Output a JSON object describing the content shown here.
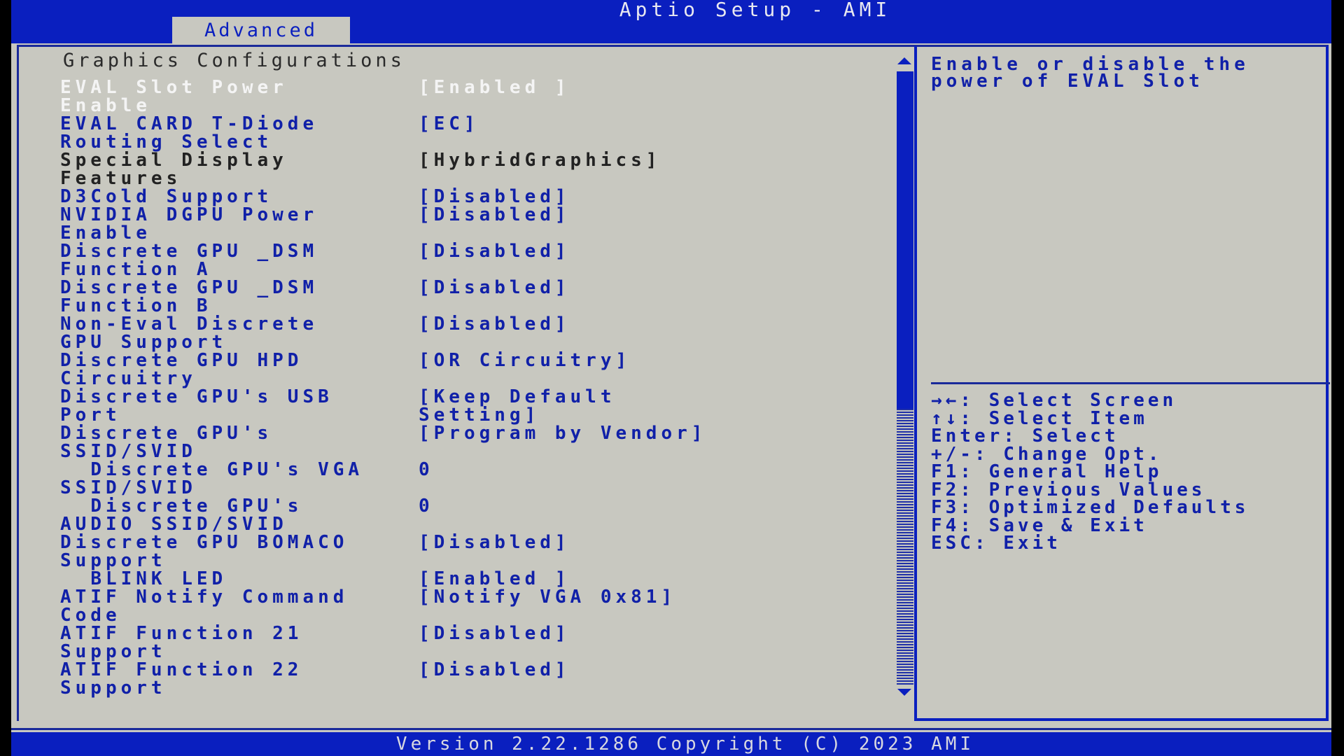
{
  "header": {
    "app_title": "Aptio Setup - AMI",
    "active_tab": "Advanced"
  },
  "main": {
    "section_title": "Graphics Configurations",
    "settings": [
      {
        "label": "EVAL Slot Power\nEnable",
        "value": "[Enabled ]",
        "state": "selected"
      },
      {
        "label": "EVAL CARD T-Diode\nRouting Select",
        "value": "[EC]"
      },
      {
        "label": "Special Display\nFeatures",
        "value": "[HybridGraphics]",
        "state": "readonly"
      },
      {
        "label": "D3Cold Support",
        "value": "[Disabled]"
      },
      {
        "label": "NVIDIA DGPU Power\nEnable",
        "value": "[Disabled]"
      },
      {
        "label": "Discrete GPU _DSM\nFunction A",
        "value": "[Disabled]"
      },
      {
        "label": "Discrete GPU _DSM\nFunction B",
        "value": "[Disabled]"
      },
      {
        "label": "Non-Eval Discrete\nGPU Support",
        "value": "[Disabled]"
      },
      {
        "label": "Discrete GPU HPD\nCircuitry",
        "value": "[OR Circuitry]"
      },
      {
        "label": "Discrete GPU's USB\nPort",
        "value": "[Keep Default\nSetting]"
      },
      {
        "label": "Discrete GPU's\nSSID/SVID",
        "value": "[Program by Vendor]"
      },
      {
        "label": "  Discrete GPU's VGA\nSSID/SVID",
        "value": "0",
        "indent": true
      },
      {
        "label": "  Discrete GPU's\nAUDIO SSID/SVID",
        "value": "0",
        "indent": true
      },
      {
        "label": "Discrete GPU BOMACO\nSupport",
        "value": "[Disabled]"
      },
      {
        "label": "  BLINK LED",
        "value": "[Enabled ]",
        "indent": true
      },
      {
        "label": "ATIF Notify Command\nCode",
        "value": "[Notify VGA 0x81]"
      },
      {
        "label": "ATIF Function 21\nSupport",
        "value": "[Disabled]"
      },
      {
        "label": "ATIF Function 22\nSupport",
        "value": "[Disabled]"
      }
    ],
    "scroll": {
      "position_fraction": 0.0,
      "visible_fraction": 0.55
    }
  },
  "help": {
    "description": "Enable or disable the power of EVAL Slot",
    "keys": [
      "→←: Select Screen",
      "↑↓: Select Item",
      "Enter: Select",
      "+/-: Change Opt.",
      "F1: General Help",
      "F2: Previous Values",
      "F3: Optimized Defaults",
      "F4: Save & Exit",
      "ESC: Exit"
    ]
  },
  "footer": {
    "text": "Version 2.22.1286 Copyright (C) 2023 AMI"
  },
  "colors": {
    "accent_blue": "#0a1fbf",
    "background_gray": "#c8c8c0",
    "selected_text": "#f4f4f4"
  }
}
